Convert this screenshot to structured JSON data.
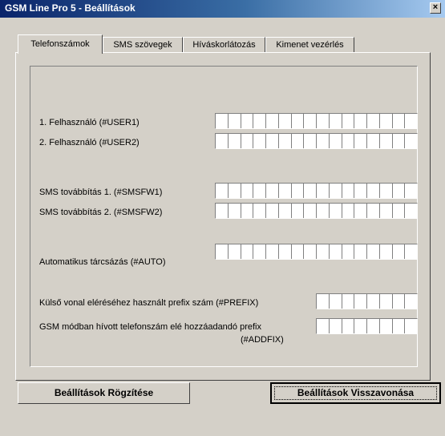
{
  "window": {
    "title": "GSM Line Pro 5  -  Beállítások",
    "close_glyph": "×"
  },
  "tabs": [
    {
      "label": "Telefonszámok",
      "active": true
    },
    {
      "label": "SMS szövegek",
      "active": false
    },
    {
      "label": "Híváskorlátozás",
      "active": false
    },
    {
      "label": "Kimenet vezérlés",
      "active": false
    }
  ],
  "fields": {
    "user1": {
      "label": "1. Felhasználó  (#USER1)",
      "value": ""
    },
    "user2": {
      "label": "2. Felhasználó  (#USER2)",
      "value": ""
    },
    "smsfw1": {
      "label": "SMS továbbítás 1.  (#SMSFW1)",
      "value": ""
    },
    "smsfw2": {
      "label": "SMS továbbítás 2.  (#SMSFW2)",
      "value": ""
    },
    "auto": {
      "label": "Automatikus tárcsázás (#AUTO)",
      "value": ""
    },
    "prefix": {
      "label": "Külső vonal eléréséhez használt prefix szám (#PREFIX)",
      "value": ""
    },
    "addfix": {
      "label_line1": "GSM módban hívott telefonszám elé hozzáadandó prefix",
      "label_line2": "(#ADDFIX)",
      "value": ""
    }
  },
  "buttons": {
    "save": "Beállítások Rögzítése",
    "revert": "Beállítások Visszavonása"
  },
  "colors": {
    "face": "#d4d0c8",
    "title_start": "#0a246a",
    "title_end": "#a6caf0"
  },
  "icons": [
    "close-icon"
  ]
}
